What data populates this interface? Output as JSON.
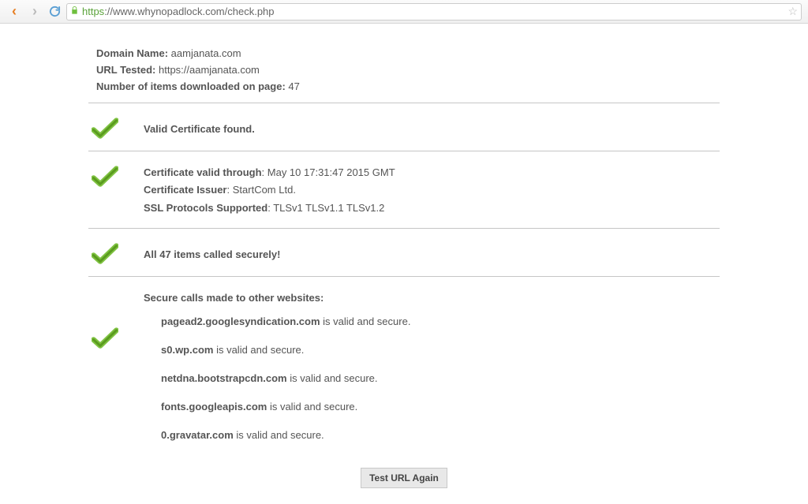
{
  "browser": {
    "url_secure_prefix": "https",
    "url_rest": "://www.whynopadlock.com/check.php"
  },
  "header": {
    "domain_label": "Domain Name:",
    "domain_value": "aamjanata.com",
    "url_tested_label": "URL Tested:",
    "url_tested_value": "https://aamjanata.com",
    "items_label": "Number of items downloaded on page:",
    "items_value": "47"
  },
  "sections": {
    "valid_cert": "Valid Certificate found.",
    "cert_through_label": "Certificate valid through",
    "cert_through_value": "May 10 17:31:47 2015 GMT",
    "issuer_label": "Certificate Issuer",
    "issuer_value": "StartCom Ltd.",
    "protocols_label": "SSL Protocols Supported",
    "protocols_value": "TLSv1 TLSv1.1 TLSv1.2",
    "all_secure": "All 47 items called securely!",
    "other_sites_title": "Secure calls made to other websites:",
    "suffix": " is valid and secure.",
    "calls": [
      "pagead2.googlesyndication.com",
      "s0.wp.com",
      "netdna.bootstrapcdn.com",
      "fonts.googleapis.com",
      "0.gravatar.com"
    ]
  },
  "button": {
    "label": "Test URL Again"
  }
}
